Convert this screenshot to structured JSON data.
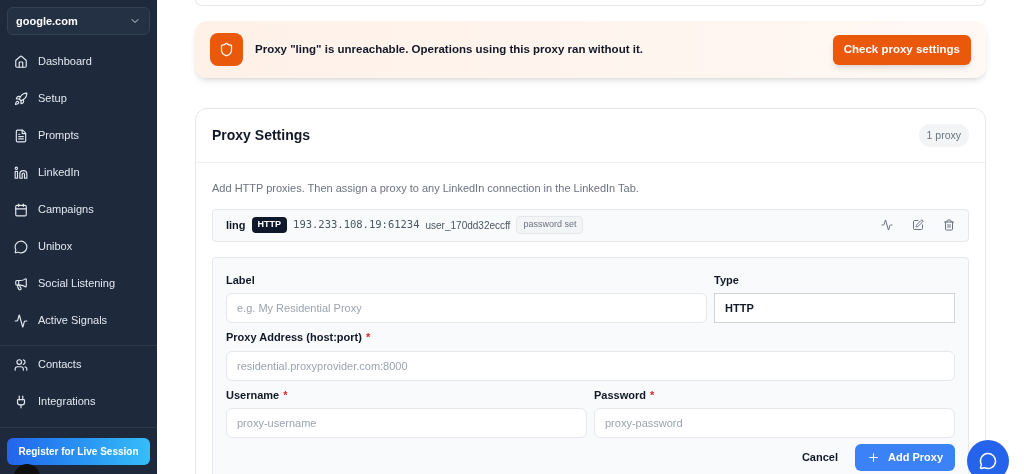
{
  "sidebar": {
    "workspace": "google.com",
    "items": [
      {
        "label": "Dashboard"
      },
      {
        "label": "Setup"
      },
      {
        "label": "Prompts"
      },
      {
        "label": "LinkedIn"
      },
      {
        "label": "Campaigns"
      },
      {
        "label": "Unibox"
      },
      {
        "label": "Social Listening"
      },
      {
        "label": "Active Signals"
      },
      {
        "label": "Contacts"
      },
      {
        "label": "Integrations"
      }
    ],
    "register_button": "Register for Live Session"
  },
  "alert": {
    "message": "Proxy \"ling\" is unreachable. Operations using this proxy ran without it.",
    "button": "Check proxy settings"
  },
  "proxy_settings": {
    "title": "Proxy Settings",
    "count": "1 proxy",
    "description": "Add HTTP proxies. Then assign a proxy to any LinkedIn connection in the LinkedIn Tab.",
    "proxies": [
      {
        "label": "ling",
        "type": "HTTP",
        "address": "193.233.108.19:61234",
        "username": "user_170dd32eccff",
        "password_badge": "password set"
      }
    ],
    "form": {
      "fields": [
        {
          "label": "Label",
          "placeholder": "e.g. My Residential Proxy"
        },
        {
          "label": "Type",
          "value": "HTTP"
        },
        {
          "label": "Proxy Address (host:port)",
          "placeholder": "residential.proxyprovider.com:8000",
          "required_mark": "*"
        },
        {
          "label": "Username",
          "placeholder": "proxy-username",
          "required_mark": "*"
        },
        {
          "label": "Password",
          "placeholder": "proxy-password",
          "required_mark": "*"
        }
      ],
      "cancel": "Cancel",
      "submit": "Add Proxy"
    }
  }
}
